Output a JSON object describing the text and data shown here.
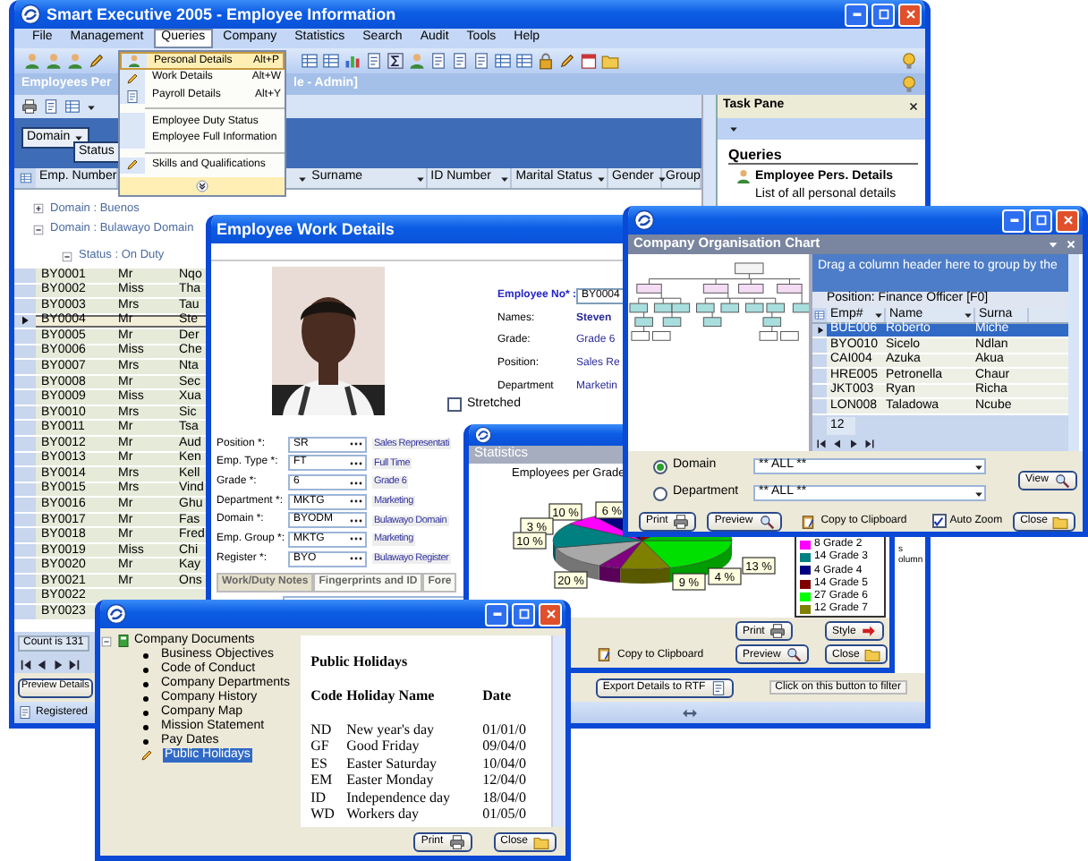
{
  "main_window": {
    "title": "Smart Executive 2005 - Employee Information",
    "menu": [
      {
        "label": "File",
        "selected": false
      },
      {
        "label": "Management",
        "selected": false
      },
      {
        "label": "Queries",
        "selected": true
      },
      {
        "label": "Company",
        "selected": false
      },
      {
        "label": "Statistics",
        "selected": false
      },
      {
        "label": "Search",
        "selected": false
      },
      {
        "label": "Audit",
        "selected": false
      },
      {
        "label": "Tools",
        "selected": false
      },
      {
        "label": "Help",
        "selected": false
      }
    ],
    "header": [
      "Employees Per",
      "le - Admin]"
    ],
    "group_by": [
      "Domain",
      "Status"
    ],
    "columns": [
      "Emp. Number",
      "Surname",
      "ID Number",
      "Marital Status",
      "Gender",
      "Group"
    ],
    "groups": [
      {
        "label": "Domain : Buenos",
        "expanded": false
      },
      {
        "label": "Domain : Bulawayo Domain",
        "expanded": true
      }
    ],
    "subgroup": {
      "label": "Status : On Duty",
      "expanded": true
    },
    "rows": [
      {
        "emp": "BY0001",
        "title": "Mr",
        "name": "Nqo",
        "selected": false
      },
      {
        "emp": "BY0002",
        "title": "Miss",
        "name": "Tha",
        "selected": false
      },
      {
        "emp": "BY0003",
        "title": "Mrs",
        "name": "Tau",
        "selected": false
      },
      {
        "emp": "BY0004",
        "title": "Mr",
        "name": "Ste",
        "selected": true
      },
      {
        "emp": "BY0005",
        "title": "Mr",
        "name": "Der",
        "selected": false
      },
      {
        "emp": "BY0006",
        "title": "Miss",
        "name": "Che",
        "selected": false
      },
      {
        "emp": "BY0007",
        "title": "Mrs",
        "name": "Nta",
        "selected": false
      },
      {
        "emp": "BY0008",
        "title": "Mr",
        "name": "Sec",
        "selected": false
      },
      {
        "emp": "BY0009",
        "title": "Miss",
        "name": "Xua",
        "selected": false
      },
      {
        "emp": "BY0010",
        "title": "Mrs",
        "name": "Sic",
        "selected": false
      },
      {
        "emp": "BY0011",
        "title": "Mr",
        "name": "Tsa",
        "selected": false
      },
      {
        "emp": "BY0012",
        "title": "Mr",
        "name": "Aud",
        "selected": false
      },
      {
        "emp": "BY0013",
        "title": "Mr",
        "name": "Ken",
        "selected": false
      },
      {
        "emp": "BY0014",
        "title": "Mrs",
        "name": "Kell",
        "selected": false
      },
      {
        "emp": "BY0015",
        "title": "Mrs",
        "name": "Vind",
        "selected": false
      },
      {
        "emp": "BY0016",
        "title": "Mr",
        "name": "Ghu",
        "selected": false
      },
      {
        "emp": "BY0017",
        "title": "Mr",
        "name": "Fas",
        "selected": false
      },
      {
        "emp": "BY0018",
        "title": "Mr",
        "name": "Fred",
        "selected": false
      },
      {
        "emp": "BY0019",
        "title": "Miss",
        "name": "Chi",
        "selected": false
      },
      {
        "emp": "BY0020",
        "title": "Mr",
        "name": "Kay",
        "selected": false
      },
      {
        "emp": "BY0021",
        "title": "Mr",
        "name": "Ons",
        "selected": false
      },
      {
        "emp": "BY0022",
        "selected": false
      },
      {
        "emp": "BY0023",
        "selected": false
      }
    ],
    "count": "Count is 131",
    "preview_button": "Preview Details",
    "export_button": "Export Details to RTF",
    "hint": "Click on this button to filter",
    "status": "Registered"
  },
  "queries_menu": [
    {
      "label": "Personal Details",
      "shortcut": "Alt+P",
      "kind": "person",
      "separator_before": false,
      "selected": true
    },
    {
      "label": "Work Details",
      "shortcut": "Alt+W",
      "kind": "pencil",
      "separator_before": false,
      "selected": false
    },
    {
      "label": "Payroll Details",
      "shortcut": "Alt+Y",
      "kind": "document",
      "separator_before": false,
      "selected": false
    },
    {
      "label": "Employee Duty Status",
      "kind": "plain",
      "separator_before": true,
      "selected": false
    },
    {
      "label": "Employee Full Information",
      "kind": "plain",
      "separator_before": false,
      "selected": false
    },
    {
      "label": "Skills and Qualifications",
      "kind": "pencil",
      "separator_before": true,
      "selected": false
    }
  ],
  "task_pane": {
    "title": "Task Pane",
    "section": "Queries",
    "link": "Employee Pers. Details",
    "description": "List of all personal details",
    "fragments": [
      "s",
      "olumn"
    ]
  },
  "work_details": {
    "title": "Employee Work Details",
    "info": [
      {
        "label": "Employee No* :",
        "value": "BY0004",
        "kind": "input"
      },
      {
        "label": "Names:",
        "value": "Steven",
        "kind": "bold"
      },
      {
        "label": "Grade:",
        "value": "Grade 6",
        "kind": "text"
      },
      {
        "label": "Position:",
        "value": "Sales Re",
        "kind": "text"
      },
      {
        "label": "Department",
        "value": "Marketin",
        "kind": "text"
      }
    ],
    "stretched": {
      "label": "Stretched",
      "checked": false
    },
    "fields": [
      {
        "label": "Position *:",
        "code": "SR",
        "description": "Sales Representati"
      },
      {
        "label": "Emp. Type *:",
        "code": "FT",
        "description": "Full Time"
      },
      {
        "label": "Grade *:",
        "code": "6",
        "description": "Grade 6"
      },
      {
        "label": "Department *:",
        "code": "MKTG",
        "description": "Marketing"
      },
      {
        "label": "Domain *:",
        "code": "BYODM",
        "description": "Bulawayo Domain"
      },
      {
        "label": "Emp. Group *:",
        "code": "MKTG",
        "description": "Marketing"
      },
      {
        "label": "Register *:",
        "code": "BYO",
        "description": "Bulawayo Register"
      }
    ],
    "tabs": [
      {
        "label": "Work/Duty Notes",
        "selected": true
      },
      {
        "label": "Fingerprints and ID",
        "selected": false
      },
      {
        "label": "Fore",
        "selected": false
      }
    ]
  },
  "statistics": {
    "header": "Statistics",
    "chart_title": "Employees per Grade",
    "slice_labels": [
      "10 %",
      "6 %",
      "3 %",
      "10 %",
      "20 %",
      "9 %",
      "4 %",
      "13 %"
    ],
    "legend": [
      {
        "label": "8 Grade 2",
        "color": "#ff00ff"
      },
      {
        "label": "14 Grade 3",
        "color": "#008080"
      },
      {
        "label": "4 Grade 4",
        "color": "#000080"
      },
      {
        "label": "14 Grade 5",
        "color": "#800000"
      },
      {
        "label": "27 Grade 6",
        "color": "#00ff00"
      },
      {
        "label": "12 Grade 7",
        "color": "#808000"
      }
    ],
    "buttons": [
      {
        "label": "Print",
        "kind": "print"
      },
      {
        "label": "Style",
        "kind": "style"
      },
      {
        "label": "Copy to Clipboard",
        "kind": "copy"
      },
      {
        "label": "Preview",
        "kind": "preview"
      },
      {
        "label": "Close",
        "kind": "close"
      }
    ]
  },
  "org_chart": {
    "header": "Company Organisation Chart",
    "group_hint": "Drag a column header here to group by the",
    "position": "Position: Finance Officer [F0]",
    "columns": [
      "Emp#",
      "Name",
      "Surna"
    ],
    "rows": [
      {
        "emp": "BUE006",
        "name": "Roberto",
        "surname": "Miche",
        "selected": true
      },
      {
        "emp": "BYO010",
        "name": "Sicelo",
        "surname": "Ndlan",
        "selected": false
      },
      {
        "emp": "CAI004",
        "name": "Azuka",
        "surname": "Akua",
        "selected": false
      },
      {
        "emp": "HRE005",
        "name": "Petronella",
        "surname": "Chaur",
        "selected": false
      },
      {
        "emp": "JKT003",
        "name": "Ryan",
        "surname": "Richa",
        "selected": false
      },
      {
        "emp": "LON008",
        "name": "Taladowa",
        "surname": "Ncube",
        "selected": false
      }
    ],
    "count": "12",
    "filters": [
      {
        "label": "Domain",
        "value": "** ALL **",
        "selected": true
      },
      {
        "label": "Department",
        "value": "** ALL **",
        "selected": false
      }
    ],
    "view_button": "View",
    "auto_zoom": {
      "label": "Auto Zoom",
      "checked": true
    },
    "buttons": [
      {
        "label": "Print",
        "kind": "print"
      },
      {
        "label": "Preview",
        "kind": "preview"
      },
      {
        "label": "Copy to Clipboard",
        "kind": "copy"
      },
      {
        "label": "Close",
        "kind": "close"
      }
    ]
  },
  "documents": {
    "tree": {
      "label": "Company Documents",
      "expanded": true,
      "children": [
        {
          "label": "Business Objectives",
          "selected": false
        },
        {
          "label": "Code of Conduct",
          "selected": false
        },
        {
          "label": "Company Departments",
          "selected": false
        },
        {
          "label": "Company History",
          "selected": false
        },
        {
          "label": "Company Map",
          "selected": false
        },
        {
          "label": "Mission Statement",
          "selected": false
        },
        {
          "label": "Pay Dates",
          "selected": false
        },
        {
          "label": "Public Holidays",
          "selected": true
        }
      ]
    },
    "document": {
      "title": "Public Holidays",
      "columns": [
        "Code",
        "Holiday Name",
        "Date"
      ],
      "rows": [
        [
          "ND",
          "New year's day",
          "01/01/0"
        ],
        [
          "GF",
          "Good Friday",
          "09/04/0"
        ],
        [
          "ES",
          "Easter Saturday",
          "10/04/0"
        ],
        [
          "EM",
          "Easter Monday",
          "12/04/0"
        ],
        [
          "ID",
          "Independence day",
          "18/04/0"
        ],
        [
          "WD",
          "Workers day",
          "01/05/0"
        ]
      ]
    },
    "buttons": [
      {
        "label": "Print",
        "kind": "print"
      },
      {
        "label": "Close",
        "kind": "close"
      }
    ]
  }
}
